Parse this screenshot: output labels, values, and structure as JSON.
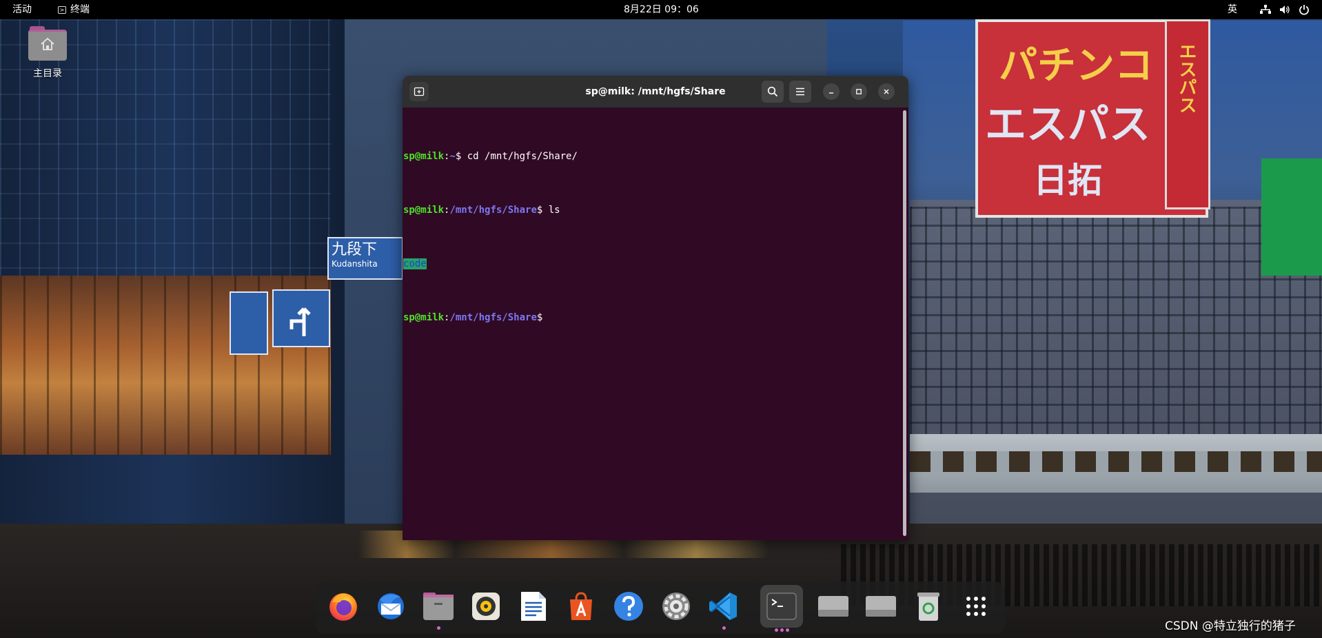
{
  "topbar": {
    "activities_label": "活动",
    "app_label": "终端",
    "clock": "8月22日 09：06",
    "input_method": "英",
    "status_icons": [
      "network-icon",
      "volume-icon",
      "power-icon"
    ]
  },
  "desktop": {
    "home_folder_label": "主目录"
  },
  "wallpaper": {
    "sign_lines": [
      "パチンコ",
      "エスパス",
      "日拓"
    ],
    "side_sign": "エスパス",
    "street_sign": "九段下",
    "street_sign_sub": "Kudanshita"
  },
  "terminal": {
    "title": "sp@milk: /mnt/hgfs/Share",
    "lines": [
      {
        "user": "sp@milk",
        "sep": ":",
        "path": "~",
        "prompt": "$",
        "command": " cd /mnt/hgfs/Share/"
      },
      {
        "user": "sp@milk",
        "sep": ":",
        "path": "/mnt/hgfs/Share",
        "prompt": "$",
        "command": " ls"
      },
      {
        "output": "code"
      },
      {
        "user": "sp@milk",
        "sep": ":",
        "path": "/mnt/hgfs/Share",
        "prompt": "$",
        "command": ""
      }
    ],
    "colors": {
      "background": "#300a24",
      "user": "#4fe22b",
      "path": "#7c77f2",
      "dir_bg": "#26a269"
    }
  },
  "dock": {
    "items": [
      {
        "name": "firefox-icon",
        "running": false
      },
      {
        "name": "thunderbird-icon",
        "running": false
      },
      {
        "name": "files-icon",
        "running": true
      },
      {
        "name": "rhythmbox-icon",
        "running": false
      },
      {
        "name": "libreoffice-writer-icon",
        "running": false
      },
      {
        "name": "software-center-icon",
        "running": false
      },
      {
        "name": "help-icon",
        "running": false
      },
      {
        "name": "settings-icon",
        "running": false
      },
      {
        "name": "vscode-icon",
        "running": true
      },
      {
        "name": "terminal-icon",
        "running": true
      },
      {
        "name": "drive-icon",
        "running": false
      },
      {
        "name": "drive-icon",
        "running": false
      },
      {
        "name": "trash-icon",
        "running": false
      },
      {
        "name": "app-grid-icon",
        "running": false
      }
    ]
  },
  "watermark": "CSDN @特立独行的猪子"
}
